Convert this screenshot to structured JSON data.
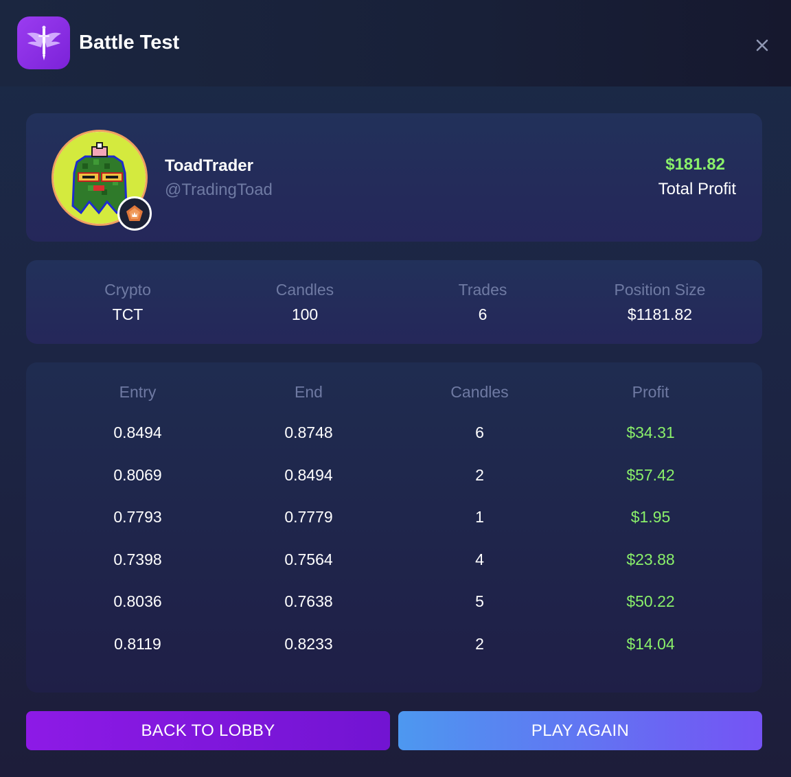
{
  "header": {
    "title": "Battle Test",
    "logo_icon": "winged-sword-icon",
    "close_icon": "close-icon"
  },
  "profile": {
    "username": "ToadTrader",
    "handle": "@TradingToad",
    "total_profit_value": "$181.82",
    "total_profit_label": "Total Profit",
    "avatar_icon": "pixel-toad-avatar",
    "rank_icon": "rank-badge-icon"
  },
  "stats": [
    {
      "label": "Crypto",
      "value": "TCT"
    },
    {
      "label": "Candles",
      "value": "100"
    },
    {
      "label": "Trades",
      "value": "6"
    },
    {
      "label": "Position Size",
      "value": "$1181.82"
    }
  ],
  "trades": {
    "columns": [
      "Entry",
      "End",
      "Candles",
      "Profit"
    ],
    "rows": [
      {
        "entry": "0.8494",
        "end": "0.8748",
        "candles": "6",
        "profit": "$34.31"
      },
      {
        "entry": "0.8069",
        "end": "0.8494",
        "candles": "2",
        "profit": "$57.42"
      },
      {
        "entry": "0.7793",
        "end": "0.7779",
        "candles": "1",
        "profit": "$1.95"
      },
      {
        "entry": "0.7398",
        "end": "0.7564",
        "candles": "4",
        "profit": "$23.88"
      },
      {
        "entry": "0.8036",
        "end": "0.7638",
        "candles": "5",
        "profit": "$50.22"
      },
      {
        "entry": "0.8119",
        "end": "0.8233",
        "candles": "2",
        "profit": "$14.04"
      }
    ]
  },
  "buttons": {
    "back_to_lobby": "BACK TO LOBBY",
    "play_again": "PLAY AGAIN"
  },
  "colors": {
    "profit_green": "#8af06a",
    "lobby_button": "#8d1ae6",
    "play_again_button": "#5b86f2",
    "muted_label": "#6f7aa3"
  }
}
